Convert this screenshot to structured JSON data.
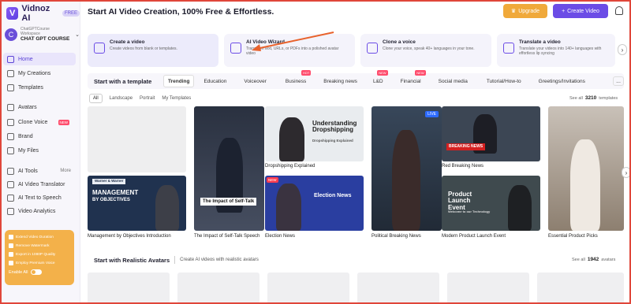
{
  "brand": {
    "name": "Vidnoz AI",
    "badge": "FREE",
    "logo_letter": "V"
  },
  "workspace": {
    "avatar_letter": "C",
    "sub_label": "ChatGPTCourse Workspace",
    "name": "CHAT GPT COURSE"
  },
  "sidebar": {
    "items": [
      {
        "label": "Home",
        "icon": "home-icon"
      },
      {
        "label": "My Creations",
        "icon": "folder-icon"
      },
      {
        "label": "Templates",
        "icon": "template-icon"
      },
      {
        "label": "Avatars",
        "icon": "avatar-icon"
      },
      {
        "label": "Clone Voice",
        "icon": "voice-icon",
        "tag": "NEW"
      },
      {
        "label": "Brand",
        "icon": "brand-icon"
      },
      {
        "label": "My Files",
        "icon": "file-icon"
      },
      {
        "label": "AI Tools",
        "icon": "tools-icon",
        "more": "More"
      },
      {
        "label": "AI Video Translator",
        "icon": "translate-icon"
      },
      {
        "label": "AI Text to Speech",
        "icon": "speech-icon"
      },
      {
        "label": "Video Analytics",
        "icon": "analytics-icon"
      }
    ]
  },
  "promo": {
    "items": [
      "Extend Video Duration",
      "Remove Watermark",
      "Export in 1080P Quality",
      "Employ Premium Voice"
    ],
    "toggle_label": "Enable All"
  },
  "header": {
    "headline": "Start AI Video Creation, 100% Free & Effortless.",
    "upgrade_label": "Upgrade",
    "create_label": "Create Video"
  },
  "tools": [
    {
      "title": "Create a video",
      "desc": "Create videos from blank or templates."
    },
    {
      "title": "AI Video Wizard",
      "desc": "Transform text, URLs, or PDFs into a polished avatar video"
    },
    {
      "title": "Clone a voice",
      "desc": "Clone your voice, speak 40+ languages in your tone."
    },
    {
      "title": "Translate a video",
      "desc": "Translate your videos into 140+ languages with effortless lip syncing"
    }
  ],
  "templates": {
    "title": "Start with a template",
    "categories": [
      {
        "label": "Trending",
        "active": true
      },
      {
        "label": "Education"
      },
      {
        "label": "Voiceover"
      },
      {
        "label": "Business",
        "tag": "HOT"
      },
      {
        "label": "Breaking news"
      },
      {
        "label": "L&D",
        "tag": "NEW"
      },
      {
        "label": "Financial",
        "tag": "NEW"
      },
      {
        "label": "Social media"
      },
      {
        "label": "Tutorial/How-to"
      },
      {
        "label": "Greetings/Invitations"
      }
    ],
    "more": "...",
    "filters": [
      "All",
      "Landscape",
      "Portrait",
      "My Templates"
    ],
    "see_all_prefix": "See all",
    "count": "3210",
    "see_all_suffix": "templates",
    "cards": [
      {
        "caption": "Management by Objectives Introduction",
        "inner_title": "MANAGEMENT",
        "inner_sub": "BY OBJECTIVES",
        "inner_top": "Warner & Warner"
      },
      {
        "caption": "The Impact of Self-Talk Speech",
        "inner_title": "The Impact of Self-Talk"
      },
      {
        "caption": "Dropshipping Explained",
        "inner_title": "Understanding Dropshipping",
        "inner_sub": "Dropshipping Explained"
      },
      {
        "caption": "Election News",
        "inner_title": "Election News",
        "badge": "NEW"
      },
      {
        "caption": "Political Breaking News",
        "badge": "LIVE"
      },
      {
        "caption": "Red Breaking News",
        "inner_title": "BREAKING NEWS"
      },
      {
        "caption": "Modern Product Launch Event",
        "inner_title": "Product Launch Event",
        "inner_sub": "Welcome to our Technology"
      },
      {
        "caption": "Essential Product Picks"
      }
    ]
  },
  "avatars": {
    "title": "Start with Realistic Avatars",
    "subtitle": "Create AI videos with realistic avatars",
    "see_all_prefix": "See all",
    "count": "1942",
    "see_all_suffix": "avatars"
  }
}
